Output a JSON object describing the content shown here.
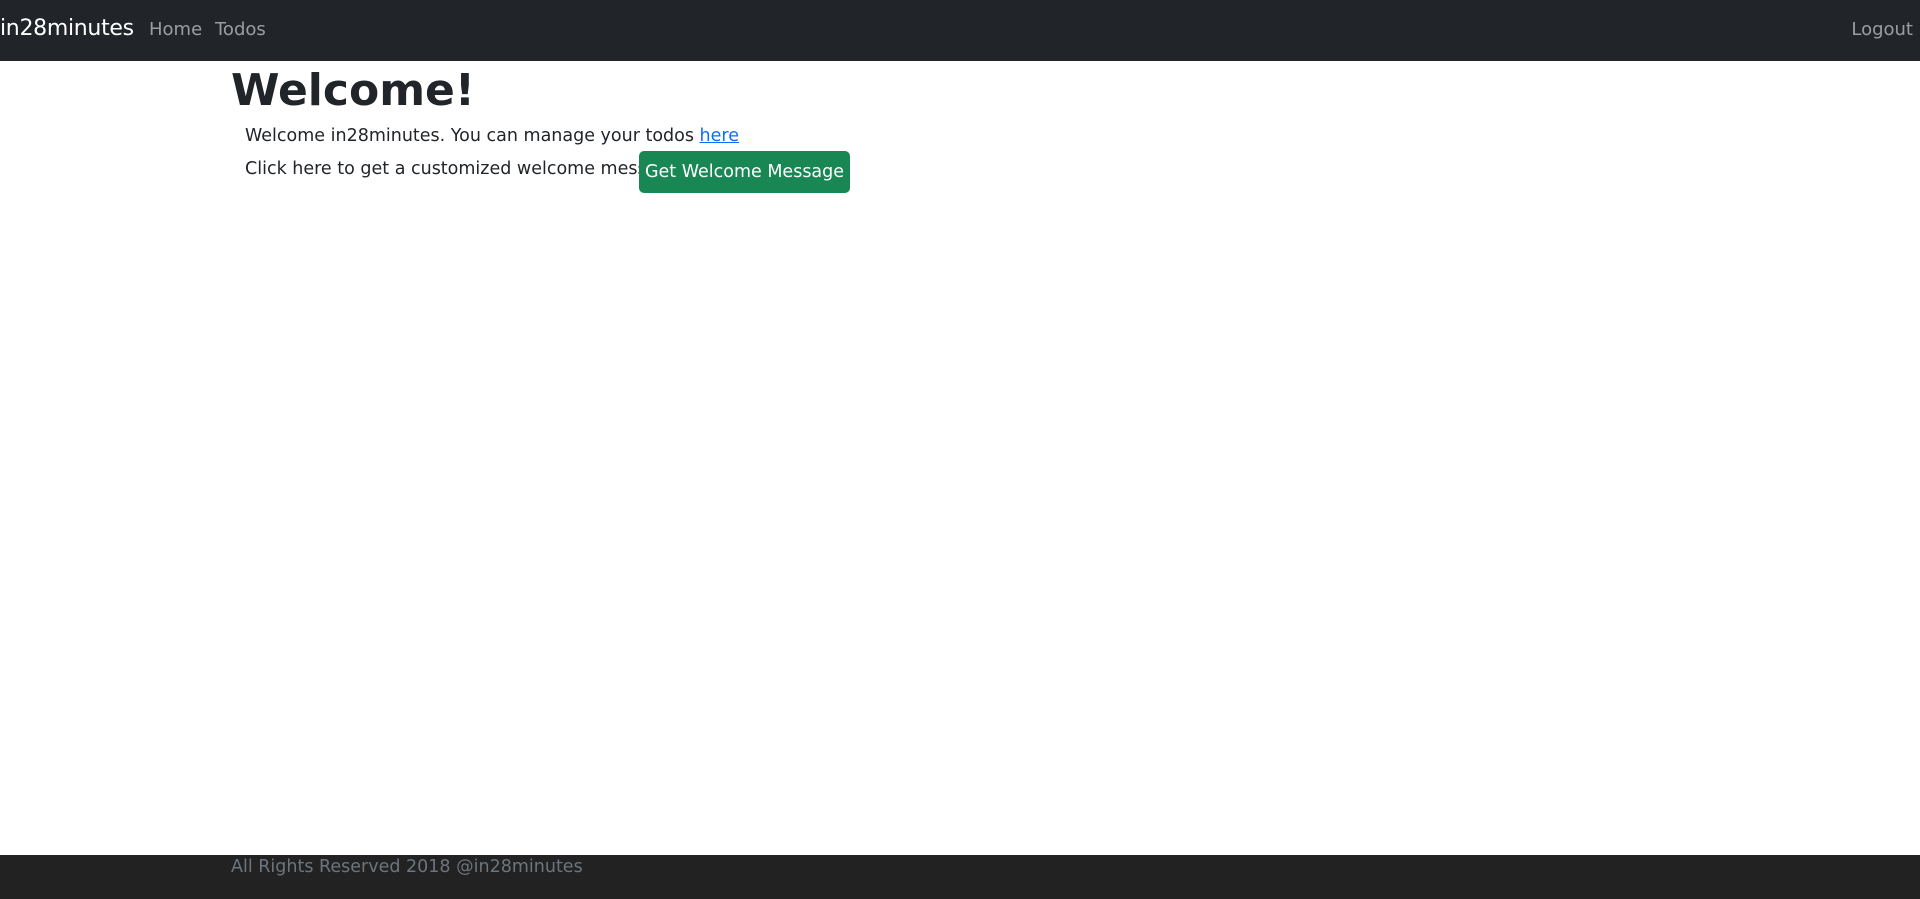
{
  "navbar": {
    "brand": "in28minutes",
    "links": [
      {
        "label": "Home"
      },
      {
        "label": "Todos"
      }
    ],
    "logout_label": "Logout"
  },
  "main": {
    "title": "Welcome!",
    "welcome_text": "Welcome in28minutes. You can manage your todos ",
    "todos_link": "here",
    "custom_message_text": "Click here to get a customized welcome message",
    "button_label": "Get Welcome Message"
  },
  "footer": {
    "text": "All Rights Reserved 2018 @in28minutes"
  },
  "colors": {
    "navbar_bg": "#212529",
    "button_bg": "#198754",
    "link": "#0d6efd",
    "footer_bg": "#222222",
    "footer_text": "#6c757d"
  }
}
